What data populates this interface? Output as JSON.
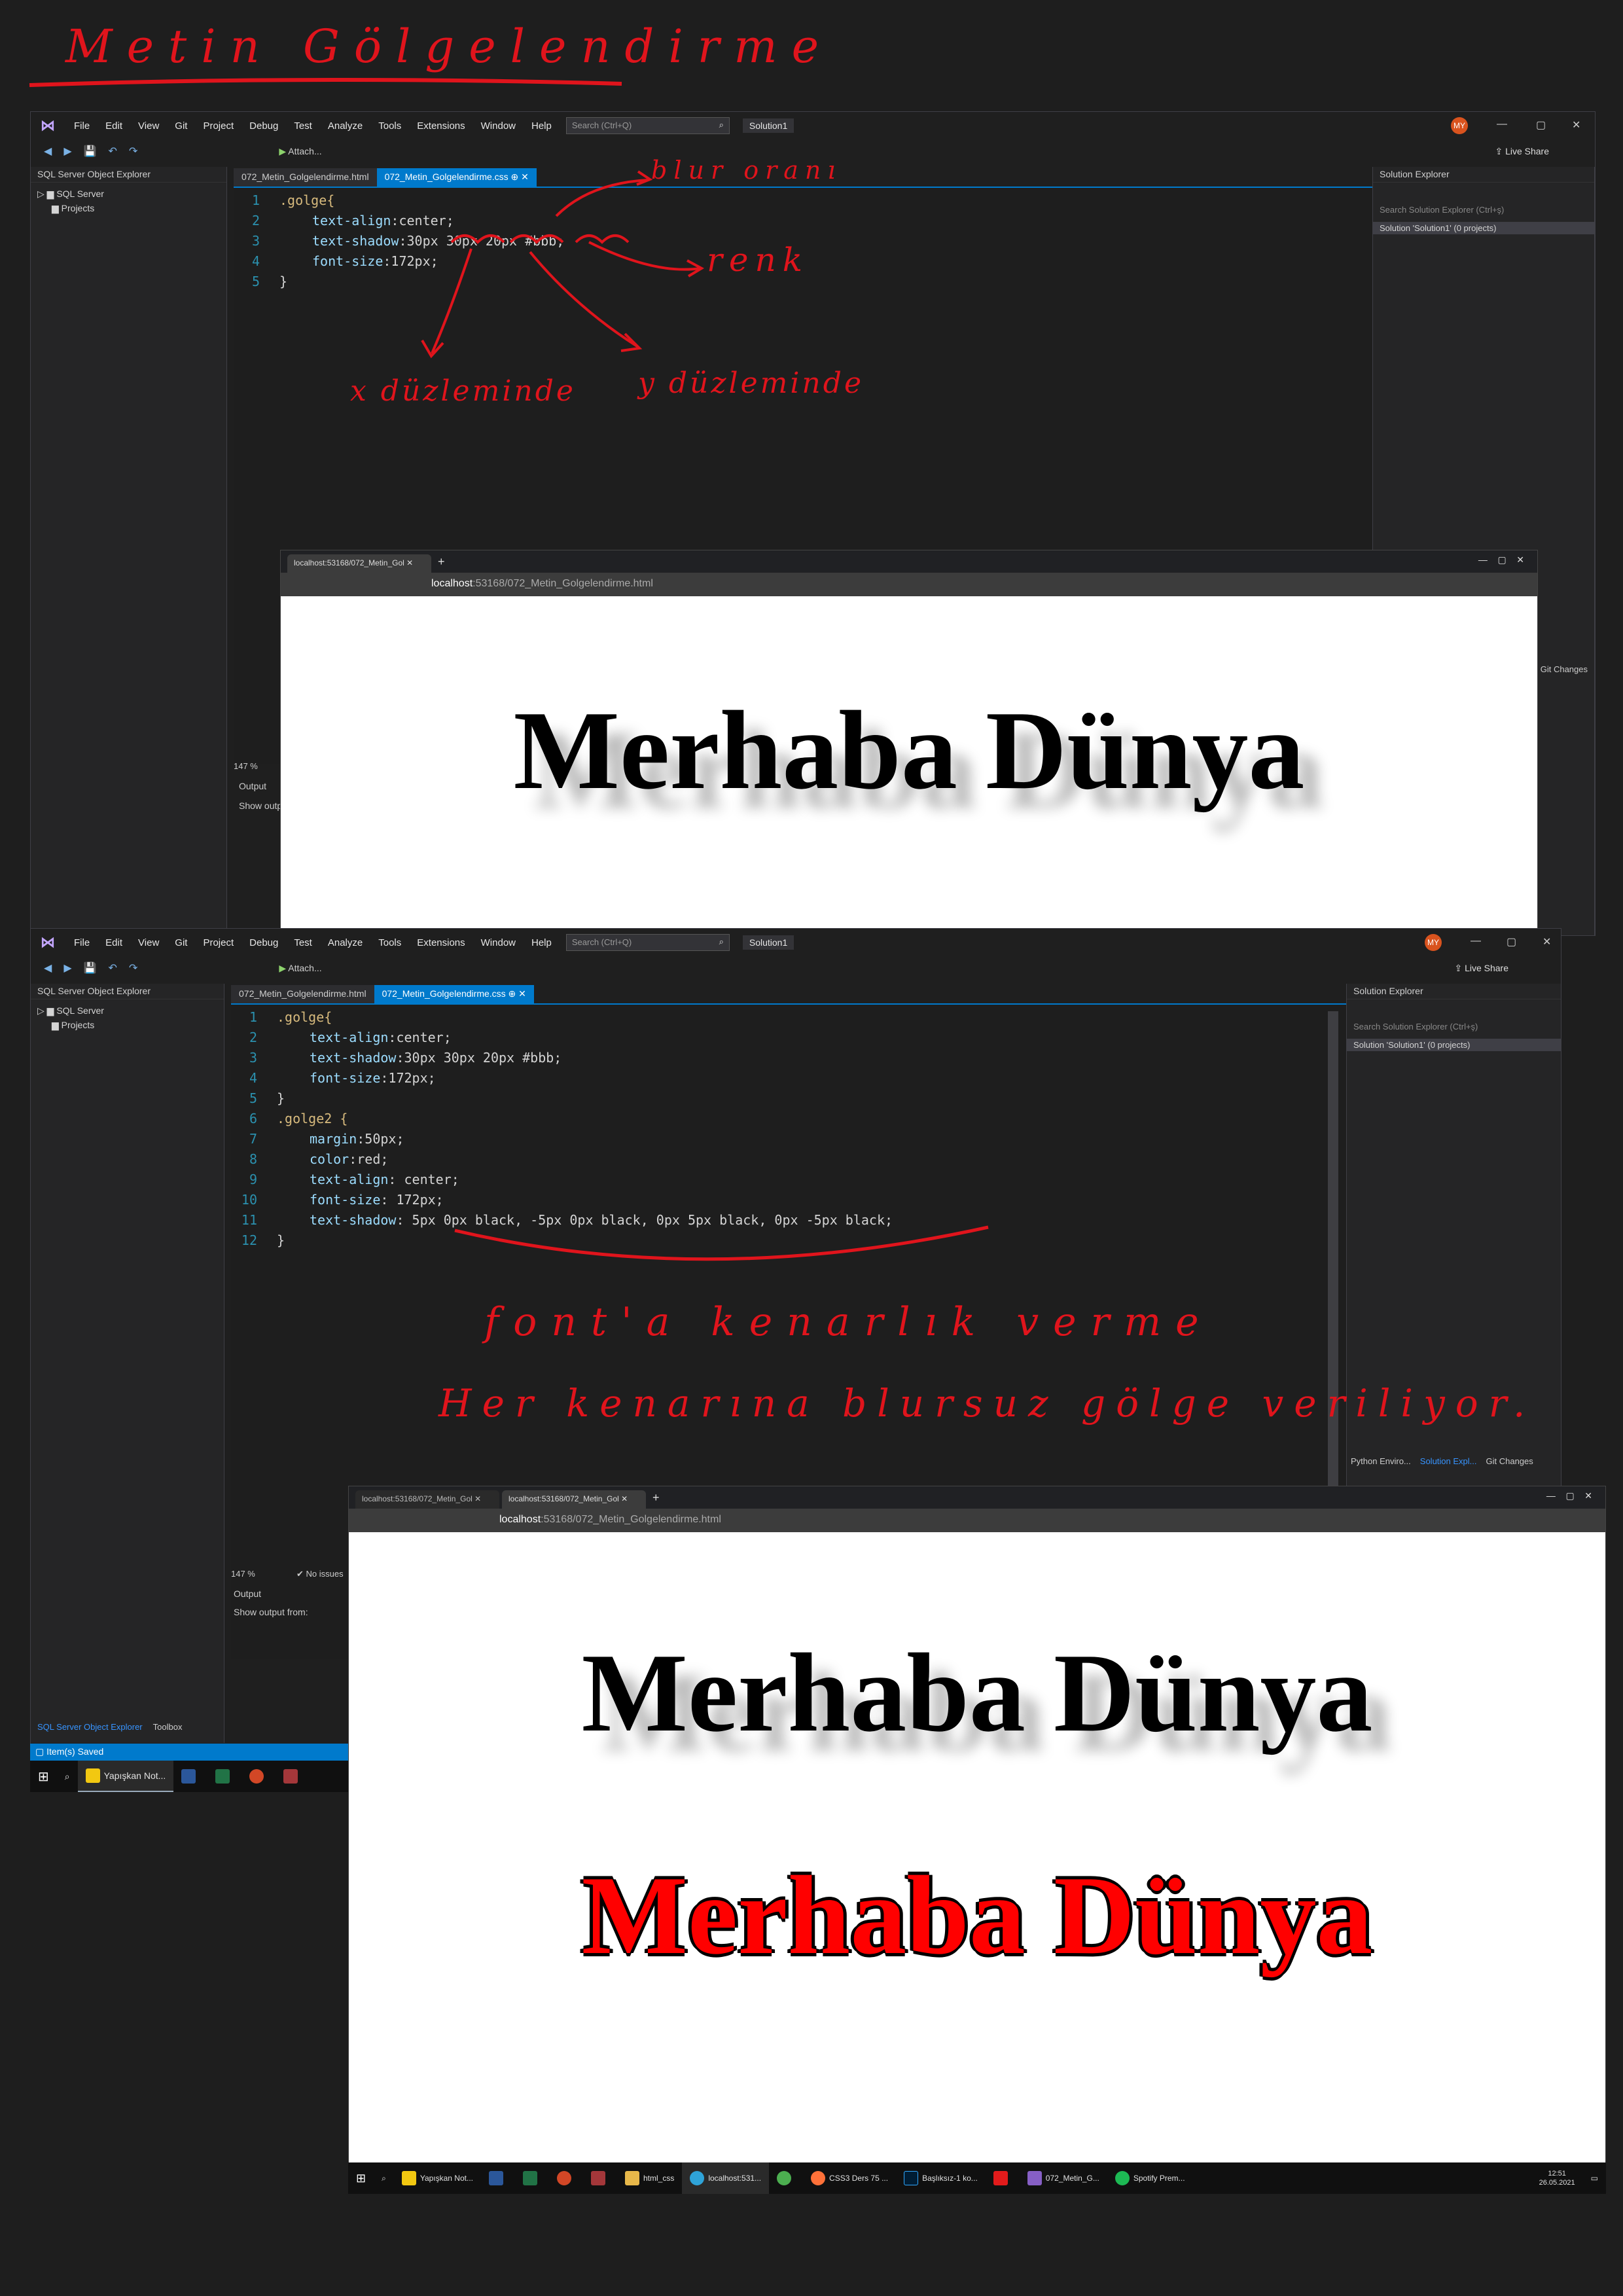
{
  "title_annotation": "Metin Gölgelendirme",
  "vs": {
    "menu": [
      "File",
      "Edit",
      "View",
      "Git",
      "Project",
      "Debug",
      "Test",
      "Analyze",
      "Tools",
      "Extensions",
      "Window",
      "Help"
    ],
    "search_placeholder": "Search (Ctrl+Q)",
    "solution": "Solution1",
    "avatar": "MY",
    "live_share": "Live Share",
    "attach": "Attach...",
    "left_panel_title": "SQL Server Object Explorer",
    "tree": [
      "SQL Server",
      "Projects"
    ],
    "right_panel_title": "Solution Explorer",
    "right_search": "Search Solution Explorer (Ctrl+ş)",
    "right_item": "Solution 'Solution1' (0 projects)",
    "tab_html": "072_Metin_Golgelendirme.html",
    "tab_css": "072_Metin_Golgelendirme.css",
    "zoom": "147 %",
    "output": "Output",
    "show_output": "Show output from:",
    "no_issues": "No issues",
    "bottom_tabs": [
      "SQL Server Object Explorer",
      "Toolbox"
    ],
    "right_bottom_tabs": [
      "Python Enviro...",
      "Solution Expl...",
      "Git Changes"
    ],
    "git_changes": "Git Changes",
    "status": "Item(s) Saved"
  },
  "code1": [
    [
      ".golge{"
    ],
    [
      "text-align",
      ":center;"
    ],
    [
      "text-shadow",
      ":30px 30px 20px #bbb;"
    ],
    [
      "font-size",
      ":172px;"
    ],
    [
      "}"
    ]
  ],
  "code2": [
    [
      ".golge{"
    ],
    [
      "text-align",
      ":center;"
    ],
    [
      "text-shadow",
      ":30px 30px 20px #bbb;"
    ],
    [
      "font-size",
      ":172px;"
    ],
    [
      "}"
    ],
    [
      ".golge2 {"
    ],
    [
      "margin",
      ":50px;"
    ],
    [
      "color",
      ":red;"
    ],
    [
      "text-align",
      ": center;"
    ],
    [
      "font-size",
      ": 172px;"
    ],
    [
      "text-shadow",
      ": 5px 0px black, -5px 0px black, 0px 5px black, 0px -5px black;"
    ],
    [
      "}"
    ]
  ],
  "annotations": {
    "blur": "blur oranı",
    "renk": "renk",
    "x": "x düzleminde",
    "y": "y düzleminde",
    "kenarlik": "font'a kenarlık verme",
    "blursuz": "Her kenarına blursuz gölge veriliyor."
  },
  "browser": {
    "tab": "localhost:53168/072_Metin_Gol",
    "host": "localhost",
    "path": ":53168/072_Metin_Golgelendirme.html",
    "heading": "Merhaba Dünya"
  },
  "taskbar1": [
    "Yapışkan Not..."
  ],
  "taskbar2": [
    "Yapışkan Not...",
    "html_css",
    "localhost:531...",
    "CSS3 Ders 75 ...",
    "Başlıksız-1 ko...",
    "072_Metin_G...",
    "Spotify Prem..."
  ],
  "clock": {
    "time": "12:51",
    "date": "26.05.2021"
  }
}
